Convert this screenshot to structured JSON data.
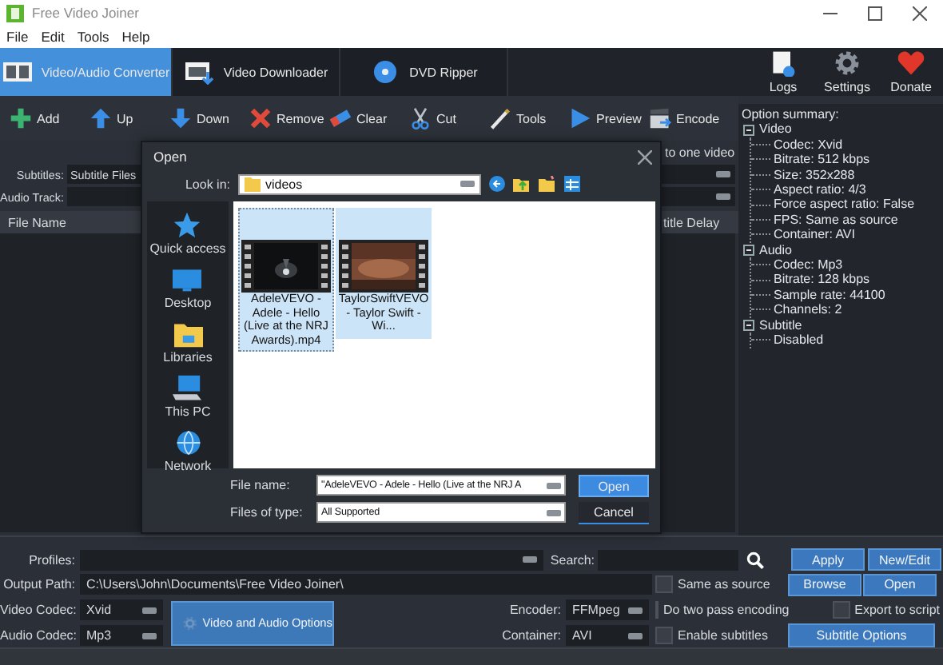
{
  "window": {
    "title": "Free Video Joiner"
  },
  "menu": [
    "File",
    "Edit",
    "Tools",
    "Help"
  ],
  "tabs": [
    {
      "label": "Video/Audio Converter",
      "selected": true
    },
    {
      "label": "Video Downloader",
      "selected": false
    },
    {
      "label": "DVD Ripper",
      "selected": false
    }
  ],
  "top_actions": [
    "Logs",
    "Settings",
    "Donate"
  ],
  "toolbar": [
    "Add",
    "Up",
    "Down",
    "Remove",
    "Clear",
    "Cut",
    "Tools",
    "Preview",
    "Encode"
  ],
  "input_panel": {
    "join_option": "to one video",
    "subtitles_label": "Subtitles:",
    "subtitles_value": "Subtitle Files",
    "audio_track_label": "Audio Track:",
    "columns": [
      "File Name",
      "title Delay"
    ]
  },
  "option_summary": {
    "title": "Option summary:",
    "tree": [
      {
        "label": "Video",
        "expanded": true,
        "children": [
          {
            "label": "Codec: Xvid"
          },
          {
            "label": "Bitrate: 512 kbps"
          },
          {
            "label": "Size: 352x288"
          },
          {
            "label": "Aspect ratio: 4/3"
          },
          {
            "label": "Force aspect ratio: False"
          },
          {
            "label": "FPS: Same as source"
          },
          {
            "label": "Container: AVI"
          }
        ]
      },
      {
        "label": "Audio",
        "expanded": true,
        "children": [
          {
            "label": "Codec: Mp3"
          },
          {
            "label": "Bitrate: 128 kbps"
          },
          {
            "label": "Sample rate: 44100"
          },
          {
            "label": "Channels: 2"
          }
        ]
      },
      {
        "label": "Subtitle",
        "expanded": true,
        "children": [
          {
            "label": "Disabled"
          }
        ]
      }
    ]
  },
  "dialog": {
    "title": "Open",
    "look_in_label": "Look in:",
    "look_in_value": "videos",
    "places": [
      "Quick access",
      "Desktop",
      "Libraries",
      "This PC",
      "Network"
    ],
    "files": [
      {
        "name": "AdeleVEVO - Adele - Hello (Live at the NRJ Awards).mp4",
        "selected": true,
        "focused": true
      },
      {
        "name": "TaylorSwiftVEVO - Taylor Swift - Wi...",
        "selected": true,
        "focused": false
      }
    ],
    "file_name_label": "File name:",
    "file_name_value": "\"AdeleVEVO - Adele - Hello (Live at the NRJ A",
    "file_type_label": "Files of type:",
    "file_type_value": "All Supported",
    "buttons": [
      "Open",
      "Cancel"
    ]
  },
  "bottom": {
    "profiles_label": "Profiles:",
    "search_label": "Search:",
    "output_path_label": "Output Path:",
    "output_path": "C:\\Users\\John\\Documents\\Free Video Joiner\\",
    "video_codec_label": "Video Codec:",
    "video_codec": "Xvid",
    "audio_codec_label": "Audio Codec:",
    "audio_codec": "Mp3",
    "options_button": "Video and Audio Options",
    "encoder_label": "Encoder:",
    "encoder": "FFMpeg",
    "container_label": "Container:",
    "container": "AVI",
    "checkboxes": [
      {
        "label": "Same as source",
        "checked": false
      },
      {
        "label": "Do two pass encoding",
        "checked": false
      },
      {
        "label": "Enable subtitles",
        "checked": false
      },
      {
        "label": "Export to script",
        "checked": false
      }
    ],
    "buttons": [
      "Apply",
      "New/Edit",
      "Browse",
      "Open"
    ],
    "subtitle_button": "Subtitle Options"
  }
}
